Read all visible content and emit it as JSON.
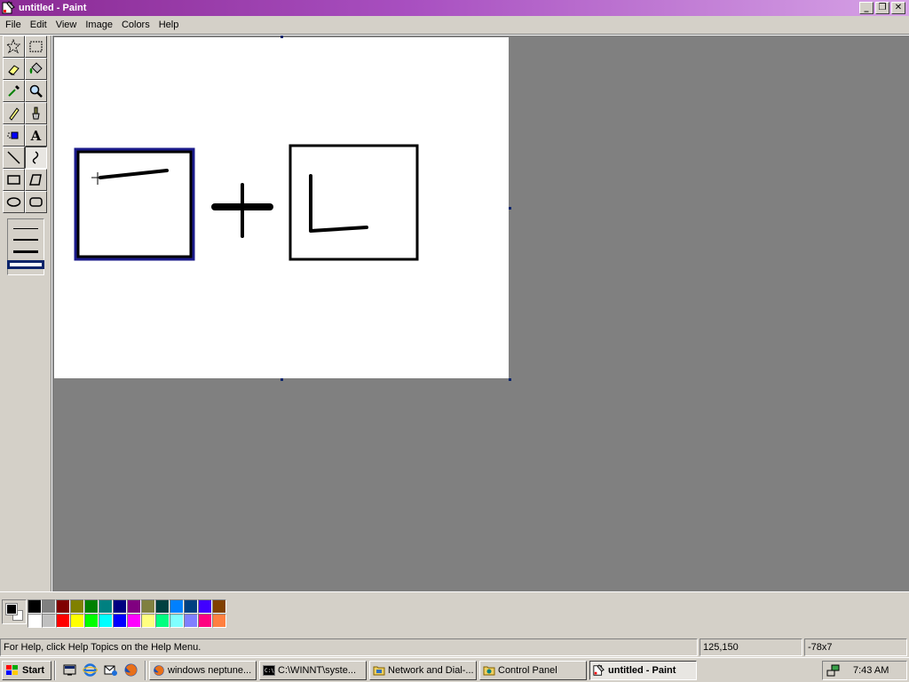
{
  "window": {
    "title": "untitled - Paint",
    "min_glyph": "_",
    "max_glyph": "❐",
    "close_glyph": "✕"
  },
  "menu": [
    "File",
    "Edit",
    "View",
    "Image",
    "Colors",
    "Help"
  ],
  "tools": [
    {
      "name": "free-form-select",
      "icon": "star-select-icon"
    },
    {
      "name": "select",
      "icon": "rect-select-icon"
    },
    {
      "name": "eraser",
      "icon": "eraser-icon"
    },
    {
      "name": "fill-with-color",
      "icon": "paint-bucket-icon"
    },
    {
      "name": "pick-color",
      "icon": "eyedropper-icon"
    },
    {
      "name": "magnifier",
      "icon": "magnifier-icon"
    },
    {
      "name": "pencil",
      "icon": "pencil-icon"
    },
    {
      "name": "brush",
      "icon": "brush-icon"
    },
    {
      "name": "airbrush",
      "icon": "airbrush-icon"
    },
    {
      "name": "text",
      "icon": "text-icon",
      "glyph": "A"
    },
    {
      "name": "line",
      "icon": "line-icon"
    },
    {
      "name": "curve",
      "icon": "curve-icon"
    },
    {
      "name": "rectangle",
      "icon": "rectangle-icon"
    },
    {
      "name": "polygon",
      "icon": "polygon-icon"
    },
    {
      "name": "ellipse",
      "icon": "ellipse-icon"
    },
    {
      "name": "rounded-rectangle",
      "icon": "rounded-rect-icon"
    }
  ],
  "active_tool": "line",
  "colors": {
    "foreground": "#000000",
    "background": "#ffffff",
    "palette_row1": [
      "#000000",
      "#808080",
      "#800000",
      "#808000",
      "#008000",
      "#008080",
      "#000080",
      "#800080",
      "#808040",
      "#004040",
      "#0080ff",
      "#004080",
      "#4000ff",
      "#804000"
    ],
    "palette_row2": [
      "#ffffff",
      "#c0c0c0",
      "#ff0000",
      "#ffff00",
      "#00ff00",
      "#00ffff",
      "#0000ff",
      "#ff00ff",
      "#ffff80",
      "#00ff80",
      "#80ffff",
      "#8080ff",
      "#ff0080",
      "#ff8040"
    ]
  },
  "status": {
    "help_text": "For Help, click Help Topics on the Help Menu.",
    "cursor_position": "125,150",
    "selection_size": "-78x7"
  },
  "taskbar": {
    "start_label": "Start",
    "quick_launch": [
      "show-desktop-icon",
      "ie-icon",
      "outlook-icon",
      "firefox-icon"
    ],
    "tasks": [
      {
        "label": "windows neptune...",
        "icon": "firefox-icon"
      },
      {
        "label": "C:\\WINNT\\syste...",
        "icon": "cmd-icon"
      },
      {
        "label": "Network and Dial-...",
        "icon": "folder-icon"
      },
      {
        "label": "Control Panel",
        "icon": "control-panel-icon"
      },
      {
        "label": "untitled - Paint",
        "icon": "paint-icon",
        "active": true
      }
    ],
    "clock": "7:43 AM"
  }
}
